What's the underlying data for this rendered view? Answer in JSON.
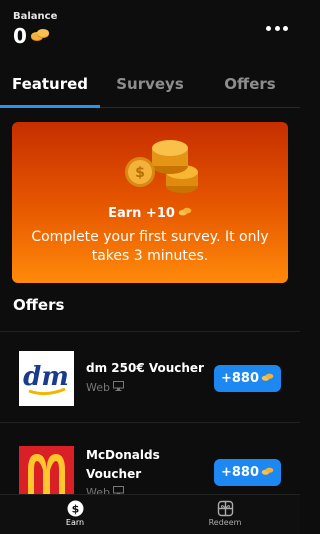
{
  "header": {
    "balance_label": "Balance",
    "balance_value": "0"
  },
  "tabs": [
    {
      "label": "Featured",
      "active": true
    },
    {
      "label": "Surveys",
      "active": false
    },
    {
      "label": "Offers",
      "active": false
    }
  ],
  "banner": {
    "earn_label": "Earn +10",
    "text": "Complete your first survey. It only takes 3 minutes."
  },
  "offers_section": {
    "title": "Offers",
    "items": [
      {
        "title": "dm 250€ Voucher",
        "platform": "Web",
        "reward": "+880",
        "logo_text": "dm"
      },
      {
        "title": "McDonalds Voucher",
        "platform": "Web",
        "reward": "+880",
        "logo_text": "M"
      }
    ]
  },
  "bottom_nav": [
    {
      "label": "Earn",
      "icon": "dollar-icon",
      "active": true
    },
    {
      "label": "Redeem",
      "icon": "gift-icon",
      "active": false
    }
  ],
  "colors": {
    "accent": "#1e88f2",
    "banner_top": "#c62e00",
    "banner_bottom": "#ff8a0a",
    "coin": "#f5a623"
  }
}
